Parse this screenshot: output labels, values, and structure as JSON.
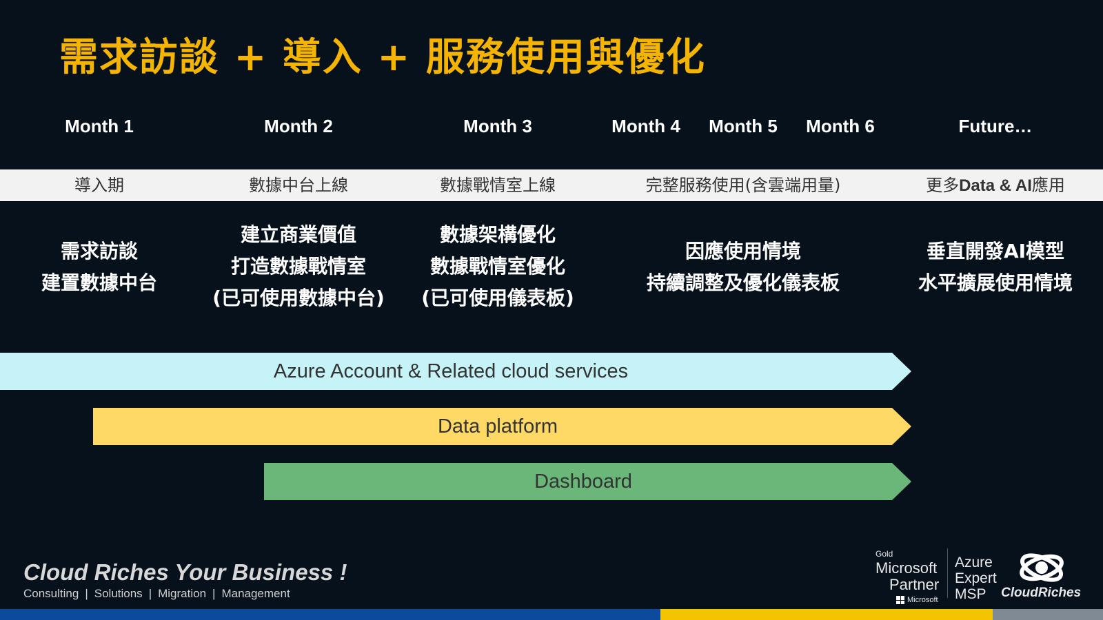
{
  "title": "需求訪談 + 導入 + 服務使用與優化",
  "months": [
    "Month 1",
    "Month 2",
    "Month 3",
    "Month 4",
    "Month 5",
    "Month 6",
    "Future…"
  ],
  "phases": {
    "p1": "導入期",
    "p2": "數據中台上線",
    "p3": "數據戰情室上線",
    "p4": "完整服務使用(含雲端用量)",
    "p5_prefix": "更多",
    "p5_bold": "Data & AI",
    "p5_suffix": "應用"
  },
  "descriptions": {
    "d1": [
      "需求訪談",
      "建置數據中台"
    ],
    "d2": [
      "建立商業價值",
      "打造數據戰情室",
      "(已可使用數據中台)"
    ],
    "d3": [
      "數據架構優化",
      "數據戰情室優化",
      "(已可使用儀表板)"
    ],
    "d4": [
      "因應使用情境",
      "持續調整及優化儀表板"
    ],
    "d5": [
      "垂直開發AI模型",
      "水平擴展使用情境"
    ]
  },
  "bars": {
    "azure": "Azure Account & Related cloud services",
    "data_platform": "Data platform",
    "dashboard": "Dashboard"
  },
  "footer": {
    "tagline": "Cloud Riches Your Business !",
    "services": [
      "Consulting",
      "Solutions",
      "Migration",
      "Management"
    ],
    "separator": "|",
    "gold": "Gold",
    "ms_partner_1": "Microsoft",
    "ms_partner_2": "Partner",
    "ms_small": "Microsoft",
    "azure_1": "Azure",
    "azure_2": "Expert",
    "azure_3": "MSP",
    "brand": "CloudRiches"
  },
  "colors": {
    "background": "#07111c",
    "title": "#f5b400",
    "azure_bar": "#c5f3f7",
    "data_bar": "#ffd966",
    "dashboard_bar": "#6ab779",
    "strip_blue": "#0b4a9c",
    "strip_yellow": "#f5c400",
    "strip_gray": "#7f8a94"
  }
}
